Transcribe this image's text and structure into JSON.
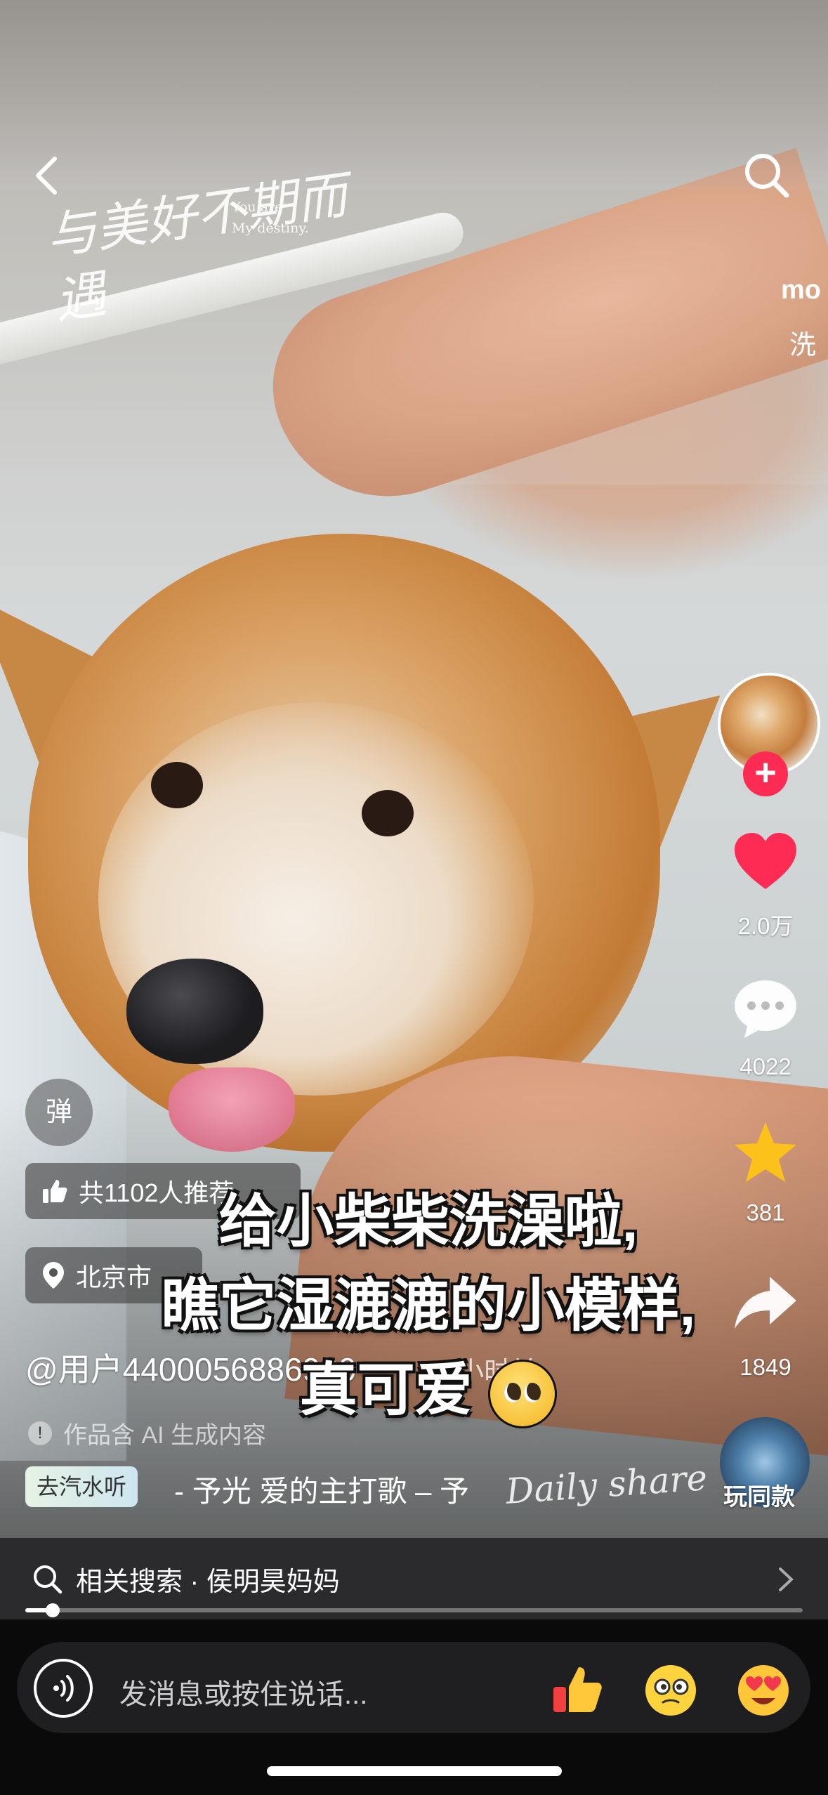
{
  "video": {
    "watermark_cn": "与美好不期而遇",
    "watermark_en_line1": "You are",
    "watermark_en_line2": "My destiny.",
    "watermark_daily": "Daily share",
    "caption_line1": "给小柴柴洗澡啦,",
    "caption_line2": "瞧它湿漉漉的小模样,",
    "caption_line3": "真可爱"
  },
  "top_bar": {
    "back_icon": "chevron-left-icon",
    "search_icon": "search-icon",
    "user_snippet": "mo",
    "desc_snippet": "洗"
  },
  "right_rail": {
    "follow_symbol": "+",
    "likes": "2.0万",
    "comments": "4022",
    "favorites": "381",
    "shares": "1849",
    "same_style_label": "玩同款"
  },
  "info": {
    "danmu_label": "弹",
    "recommend_text": "共1102人推荐",
    "location_text": "北京市",
    "author": "@用户4400056886990",
    "time_ago": "3小时前",
    "ai_note": "作品含 AI 生成内容",
    "music_chip": "去汽水听",
    "music_text": "- 予光   爱的主打歌 – 予"
  },
  "related_search": {
    "label": "相关搜索 · 侯明昊妈妈"
  },
  "progress": {
    "fraction": 0.035
  },
  "bottom_bar": {
    "placeholder": "发消息或按住说话...",
    "emojis": [
      "thumbs-up-icon",
      "dizzy-face-icon",
      "heart-eyes-icon"
    ]
  },
  "colors": {
    "accent_red": "#fe2c55",
    "like_red": "#fe2c55",
    "star_yellow": "#fcc21b"
  }
}
